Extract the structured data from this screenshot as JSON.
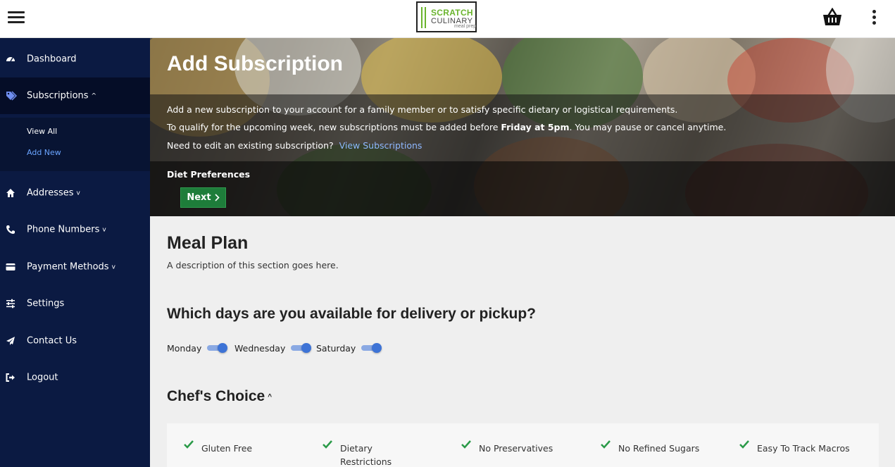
{
  "header": {
    "logo": {
      "line1": "SCRATCH",
      "line2": "CULINARY",
      "line3": "meal prep"
    }
  },
  "sidebar": {
    "items": [
      {
        "label": "Dashboard",
        "icon": "dashboard-icon"
      },
      {
        "label": "Subscriptions",
        "icon": "tags-icon",
        "expanded": true
      },
      {
        "label": "Addresses",
        "icon": "home-icon"
      },
      {
        "label": "Phone Numbers",
        "icon": "phone-icon"
      },
      {
        "label": "Payment Methods",
        "icon": "credit-card-icon"
      },
      {
        "label": "Settings",
        "icon": "sliders-icon"
      },
      {
        "label": "Contact Us",
        "icon": "paper-plane-icon"
      },
      {
        "label": "Logout",
        "icon": "sign-out-icon"
      }
    ],
    "sub_items": [
      {
        "label": "View All"
      },
      {
        "label": "Add New",
        "current": true
      }
    ]
  },
  "hero": {
    "title": "Add Subscription",
    "line1": "Add a new subscription to your account for a family member or to satisfy specific dietary or logistical requirements.",
    "line2_pre": "To qualify for the upcoming week, new subscriptions must be added before ",
    "line2_bold": "Friday at 5pm",
    "line2_post": ". You may pause or cancel anytime.",
    "line3_pre": "Need to edit an existing subscription?",
    "line3_link": "View Subscriptions",
    "step_label": "Diet Preferences",
    "next_label": "Next"
  },
  "main": {
    "section_title": "Meal Plan",
    "section_desc": "A description of this section goes here.",
    "days_question": "Which days are you available for delivery or pickup?",
    "days": [
      {
        "label": "Monday",
        "on": true
      },
      {
        "label": "Wednesday",
        "on": true
      },
      {
        "label": "Saturday",
        "on": true
      }
    ],
    "plan_title": "Chef's Choice",
    "features": [
      "Gluten Free",
      "Dietary Restrictions\nAccommodated",
      "No Preservatives",
      "No Refined Sugars",
      "Easy To Track Macros"
    ]
  },
  "colors": {
    "sidebar_bg": "#0b1a42",
    "accent_blue": "#3d73d6",
    "next_button_green": "#1e7d3a",
    "check_green": "#2a9a48",
    "logo_green": "#6ab42d"
  }
}
